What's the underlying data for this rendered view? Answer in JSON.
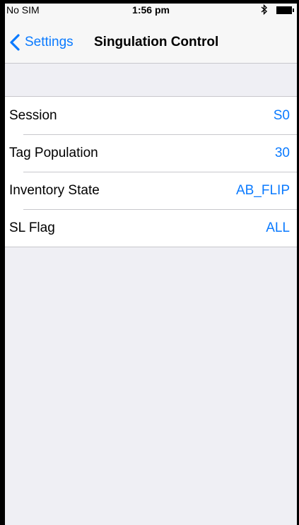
{
  "status_bar": {
    "carrier": "No SIM",
    "time": "1:56 pm",
    "bluetooth_symbol": "✳",
    "icons": [
      "bluetooth-icon",
      "battery-icon"
    ]
  },
  "nav": {
    "back_label": "Settings",
    "title": "Singulation Control",
    "back_icon": "chevron-left-icon"
  },
  "settings": [
    {
      "label": "Session",
      "value": "S0"
    },
    {
      "label": "Tag Population",
      "value": "30"
    },
    {
      "label": "Inventory State",
      "value": "AB_FLIP"
    },
    {
      "label": "SL Flag",
      "value": "ALL"
    }
  ],
  "colors": {
    "accent": "#0a7aff",
    "background": "#efeff4",
    "separator": "#c8c7cc"
  }
}
